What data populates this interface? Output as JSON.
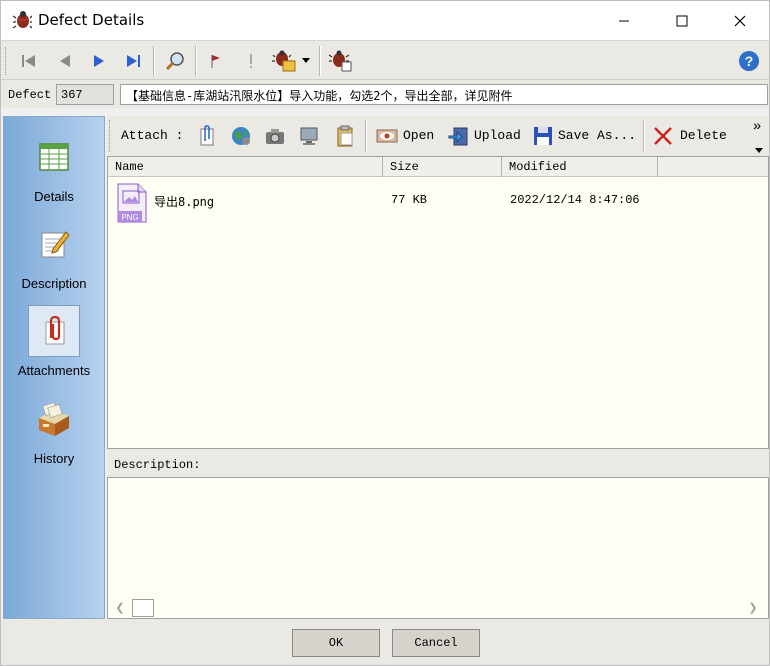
{
  "window": {
    "title": "Defect Details"
  },
  "toolbar": {
    "icons": [
      "first-record-icon",
      "previous-record-icon",
      "next-record-icon",
      "last-record-icon",
      "find-icon",
      "flag-icon",
      "exclamation-icon",
      "defect-actions-icon",
      "defect-link-icon",
      "help-icon"
    ]
  },
  "defect": {
    "label": "Defect",
    "id": "367",
    "summary": "【基础信息-库湖站汛限水位】导入功能，勾选2个，导出全部，详见附件"
  },
  "nav": {
    "items": [
      {
        "label": "Details"
      },
      {
        "label": "Description"
      },
      {
        "label": "Attachments"
      },
      {
        "label": "History"
      }
    ],
    "selected": "Attachments"
  },
  "attachments": {
    "toolbar": {
      "attach_label": "Attach :",
      "open_label": "Open",
      "upload_label": "Upload",
      "save_as_label": "Save As...",
      "delete_label": "Delete",
      "more_label": "»"
    },
    "columns": [
      "Name",
      "Size",
      "Modified"
    ],
    "files": [
      {
        "name": "导出8.png",
        "size": "77 KB",
        "modified": "2022/12/14 8:47:06",
        "type_badge": "PNG"
      }
    ],
    "description_label": "Description:"
  },
  "buttons": {
    "ok": "OK",
    "cancel": "Cancel"
  },
  "colors": {
    "nav_gradient_start": "#7ba8d8",
    "nav_gradient_end": "#b7d2ee",
    "list_bg": "#fffef5",
    "chrome": "#ebe9e3"
  }
}
